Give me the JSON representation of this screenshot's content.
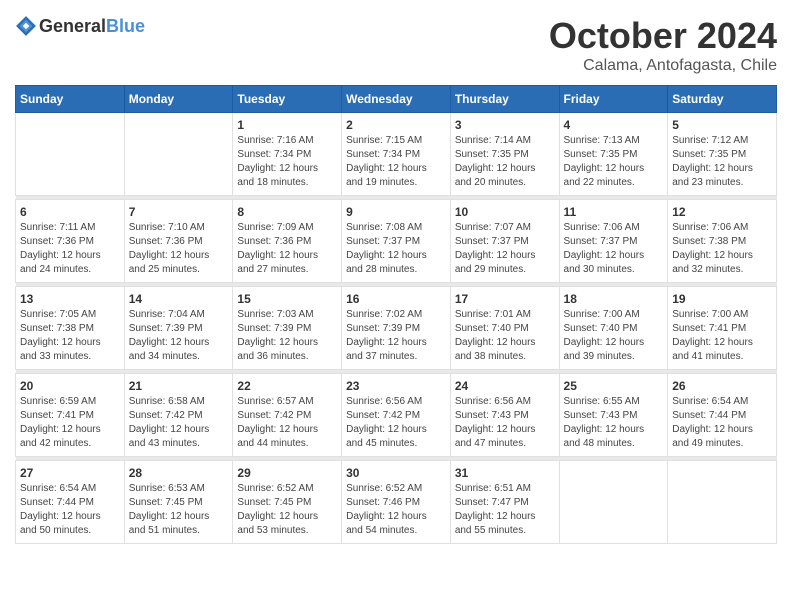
{
  "logo": {
    "text_general": "General",
    "text_blue": "Blue"
  },
  "header": {
    "month": "October 2024",
    "location": "Calama, Antofagasta, Chile"
  },
  "days_of_week": [
    "Sunday",
    "Monday",
    "Tuesday",
    "Wednesday",
    "Thursday",
    "Friday",
    "Saturday"
  ],
  "weeks": [
    [
      {
        "day": "",
        "sunrise": "",
        "sunset": "",
        "daylight": ""
      },
      {
        "day": "",
        "sunrise": "",
        "sunset": "",
        "daylight": ""
      },
      {
        "day": "1",
        "sunrise": "Sunrise: 7:16 AM",
        "sunset": "Sunset: 7:34 PM",
        "daylight": "Daylight: 12 hours and 18 minutes."
      },
      {
        "day": "2",
        "sunrise": "Sunrise: 7:15 AM",
        "sunset": "Sunset: 7:34 PM",
        "daylight": "Daylight: 12 hours and 19 minutes."
      },
      {
        "day": "3",
        "sunrise": "Sunrise: 7:14 AM",
        "sunset": "Sunset: 7:35 PM",
        "daylight": "Daylight: 12 hours and 20 minutes."
      },
      {
        "day": "4",
        "sunrise": "Sunrise: 7:13 AM",
        "sunset": "Sunset: 7:35 PM",
        "daylight": "Daylight: 12 hours and 22 minutes."
      },
      {
        "day": "5",
        "sunrise": "Sunrise: 7:12 AM",
        "sunset": "Sunset: 7:35 PM",
        "daylight": "Daylight: 12 hours and 23 minutes."
      }
    ],
    [
      {
        "day": "6",
        "sunrise": "Sunrise: 7:11 AM",
        "sunset": "Sunset: 7:36 PM",
        "daylight": "Daylight: 12 hours and 24 minutes."
      },
      {
        "day": "7",
        "sunrise": "Sunrise: 7:10 AM",
        "sunset": "Sunset: 7:36 PM",
        "daylight": "Daylight: 12 hours and 25 minutes."
      },
      {
        "day": "8",
        "sunrise": "Sunrise: 7:09 AM",
        "sunset": "Sunset: 7:36 PM",
        "daylight": "Daylight: 12 hours and 27 minutes."
      },
      {
        "day": "9",
        "sunrise": "Sunrise: 7:08 AM",
        "sunset": "Sunset: 7:37 PM",
        "daylight": "Daylight: 12 hours and 28 minutes."
      },
      {
        "day": "10",
        "sunrise": "Sunrise: 7:07 AM",
        "sunset": "Sunset: 7:37 PM",
        "daylight": "Daylight: 12 hours and 29 minutes."
      },
      {
        "day": "11",
        "sunrise": "Sunrise: 7:06 AM",
        "sunset": "Sunset: 7:37 PM",
        "daylight": "Daylight: 12 hours and 30 minutes."
      },
      {
        "day": "12",
        "sunrise": "Sunrise: 7:06 AM",
        "sunset": "Sunset: 7:38 PM",
        "daylight": "Daylight: 12 hours and 32 minutes."
      }
    ],
    [
      {
        "day": "13",
        "sunrise": "Sunrise: 7:05 AM",
        "sunset": "Sunset: 7:38 PM",
        "daylight": "Daylight: 12 hours and 33 minutes."
      },
      {
        "day": "14",
        "sunrise": "Sunrise: 7:04 AM",
        "sunset": "Sunset: 7:39 PM",
        "daylight": "Daylight: 12 hours and 34 minutes."
      },
      {
        "day": "15",
        "sunrise": "Sunrise: 7:03 AM",
        "sunset": "Sunset: 7:39 PM",
        "daylight": "Daylight: 12 hours and 36 minutes."
      },
      {
        "day": "16",
        "sunrise": "Sunrise: 7:02 AM",
        "sunset": "Sunset: 7:39 PM",
        "daylight": "Daylight: 12 hours and 37 minutes."
      },
      {
        "day": "17",
        "sunrise": "Sunrise: 7:01 AM",
        "sunset": "Sunset: 7:40 PM",
        "daylight": "Daylight: 12 hours and 38 minutes."
      },
      {
        "day": "18",
        "sunrise": "Sunrise: 7:00 AM",
        "sunset": "Sunset: 7:40 PM",
        "daylight": "Daylight: 12 hours and 39 minutes."
      },
      {
        "day": "19",
        "sunrise": "Sunrise: 7:00 AM",
        "sunset": "Sunset: 7:41 PM",
        "daylight": "Daylight: 12 hours and 41 minutes."
      }
    ],
    [
      {
        "day": "20",
        "sunrise": "Sunrise: 6:59 AM",
        "sunset": "Sunset: 7:41 PM",
        "daylight": "Daylight: 12 hours and 42 minutes."
      },
      {
        "day": "21",
        "sunrise": "Sunrise: 6:58 AM",
        "sunset": "Sunset: 7:42 PM",
        "daylight": "Daylight: 12 hours and 43 minutes."
      },
      {
        "day": "22",
        "sunrise": "Sunrise: 6:57 AM",
        "sunset": "Sunset: 7:42 PM",
        "daylight": "Daylight: 12 hours and 44 minutes."
      },
      {
        "day": "23",
        "sunrise": "Sunrise: 6:56 AM",
        "sunset": "Sunset: 7:42 PM",
        "daylight": "Daylight: 12 hours and 45 minutes."
      },
      {
        "day": "24",
        "sunrise": "Sunrise: 6:56 AM",
        "sunset": "Sunset: 7:43 PM",
        "daylight": "Daylight: 12 hours and 47 minutes."
      },
      {
        "day": "25",
        "sunrise": "Sunrise: 6:55 AM",
        "sunset": "Sunset: 7:43 PM",
        "daylight": "Daylight: 12 hours and 48 minutes."
      },
      {
        "day": "26",
        "sunrise": "Sunrise: 6:54 AM",
        "sunset": "Sunset: 7:44 PM",
        "daylight": "Daylight: 12 hours and 49 minutes."
      }
    ],
    [
      {
        "day": "27",
        "sunrise": "Sunrise: 6:54 AM",
        "sunset": "Sunset: 7:44 PM",
        "daylight": "Daylight: 12 hours and 50 minutes."
      },
      {
        "day": "28",
        "sunrise": "Sunrise: 6:53 AM",
        "sunset": "Sunset: 7:45 PM",
        "daylight": "Daylight: 12 hours and 51 minutes."
      },
      {
        "day": "29",
        "sunrise": "Sunrise: 6:52 AM",
        "sunset": "Sunset: 7:45 PM",
        "daylight": "Daylight: 12 hours and 53 minutes."
      },
      {
        "day": "30",
        "sunrise": "Sunrise: 6:52 AM",
        "sunset": "Sunset: 7:46 PM",
        "daylight": "Daylight: 12 hours and 54 minutes."
      },
      {
        "day": "31",
        "sunrise": "Sunrise: 6:51 AM",
        "sunset": "Sunset: 7:47 PM",
        "daylight": "Daylight: 12 hours and 55 minutes."
      },
      {
        "day": "",
        "sunrise": "",
        "sunset": "",
        "daylight": ""
      },
      {
        "day": "",
        "sunrise": "",
        "sunset": "",
        "daylight": ""
      }
    ]
  ]
}
